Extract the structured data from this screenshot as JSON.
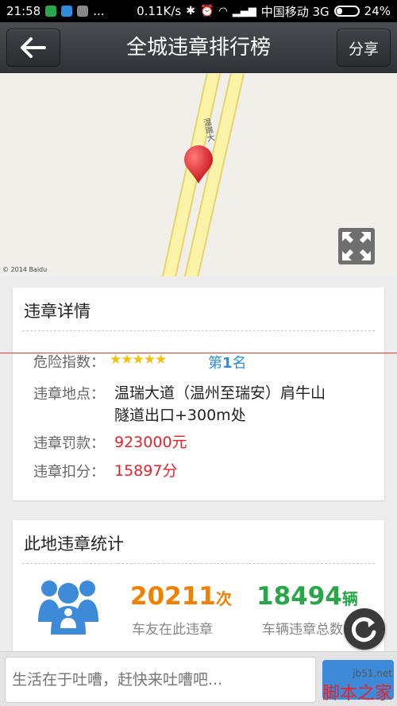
{
  "status_bar": {
    "time": "21:58",
    "dots": "...",
    "speed": "0.11K/s",
    "carrier": "中国移动 3G",
    "battery": "24%"
  },
  "header": {
    "title": "全城违章排行榜",
    "share_label": "分享",
    "back_icon": "arrow-left-icon"
  },
  "map": {
    "road_label": "温瑞大",
    "credit": "© 2014 Baidu",
    "pin_color": "#e52a2a"
  },
  "detail_card": {
    "title": "违章详情",
    "risk_label": "危险指数：",
    "rank_prefix": "第",
    "rank_num": "1",
    "rank_suffix": "名",
    "location_label": "违章地点：",
    "location_line1": "温瑞大道（温州至瑞安）肩牛山",
    "location_line2": "隧道出口+300m处",
    "fine_label": "违章罚款：",
    "fine_value": "923000元",
    "points_label": "违章扣分：",
    "points_value": "15897分",
    "stars": 5
  },
  "stats_card": {
    "title": "此地违章统计",
    "count1": "20211",
    "count1_unit": "次",
    "count1_label": "车友在此违章",
    "count2": "18494",
    "count2_unit": "辆",
    "count2_label": "车辆违章总数"
  },
  "comment": {
    "placeholder": "生活在于吐嘈，赶快来吐嘈吧..."
  },
  "watermark": {
    "line1": "jb51.net",
    "line2": "脚本之家"
  },
  "colors": {
    "accent_red": "#e5232b",
    "accent_blue": "#2e8ddb",
    "accent_orange": "#f08000",
    "accent_green": "#2aa64a",
    "icon_blue": "#3d8ad8"
  }
}
